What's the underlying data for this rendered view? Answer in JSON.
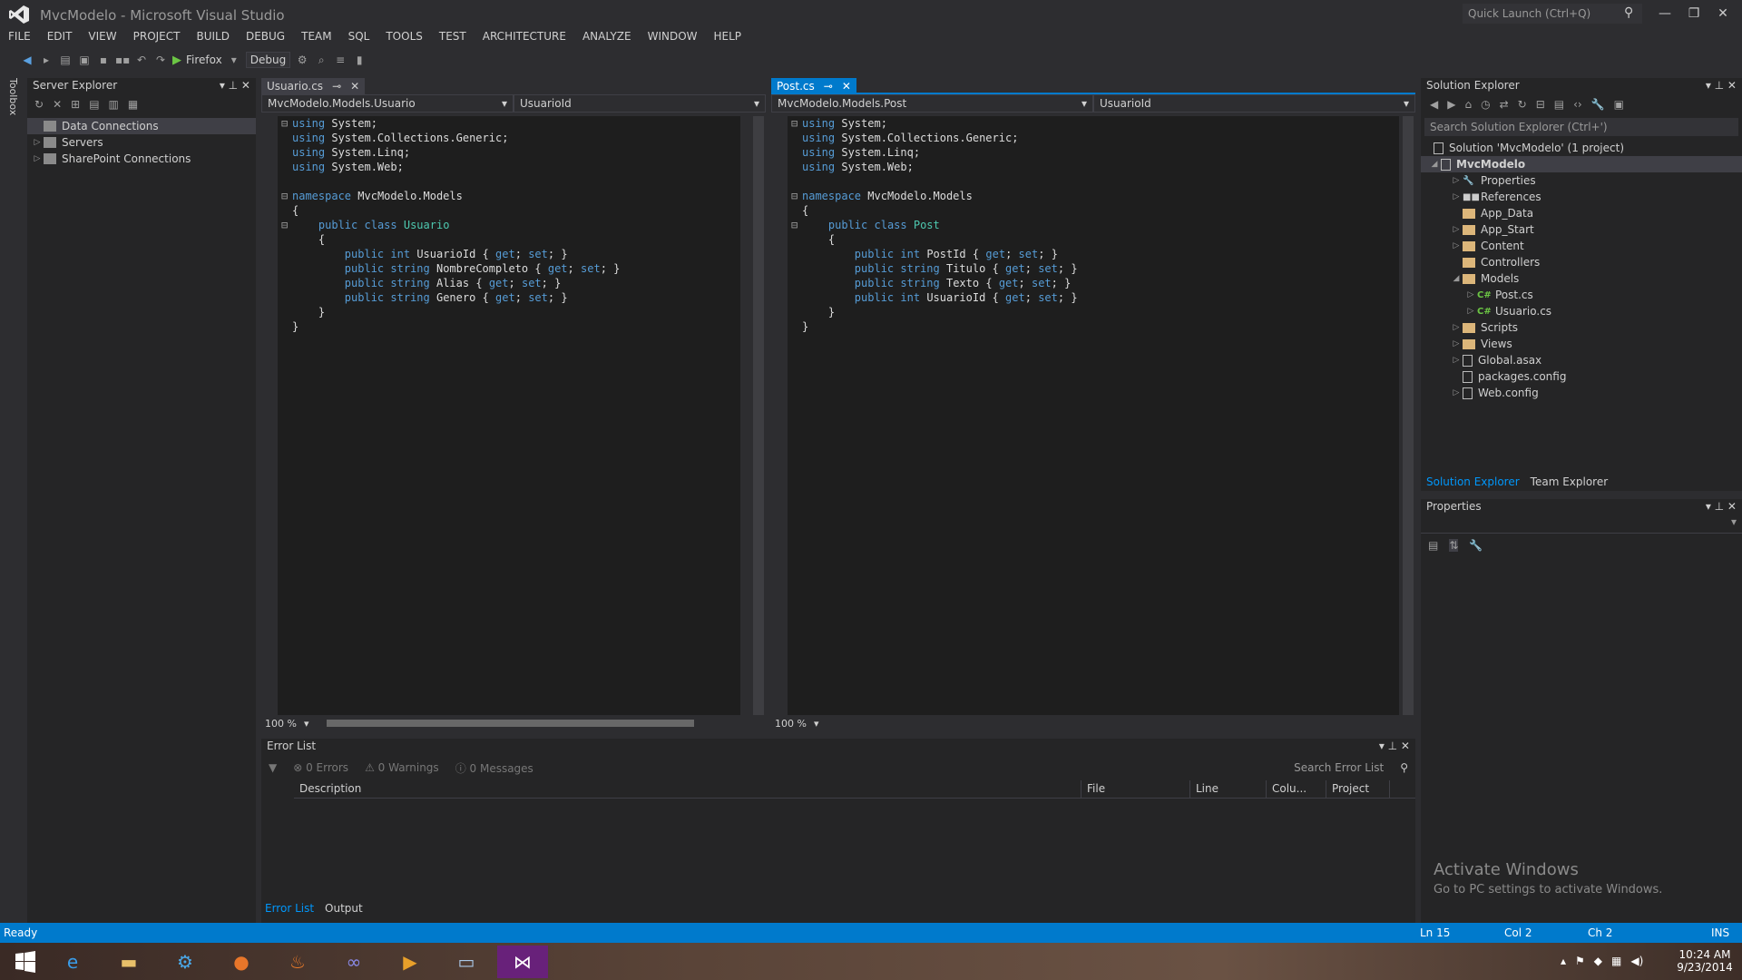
{
  "window": {
    "title": "MvcModelo - Microsoft Visual Studio",
    "quick_launch_placeholder": "Quick Launch (Ctrl+Q)"
  },
  "menu": [
    "FILE",
    "EDIT",
    "VIEW",
    "PROJECT",
    "BUILD",
    "DEBUG",
    "TEAM",
    "SQL",
    "TOOLS",
    "TEST",
    "ARCHITECTURE",
    "ANALYZE",
    "WINDOW",
    "HELP"
  ],
  "toolbar": {
    "run_target": "Firefox",
    "configuration": "Debug"
  },
  "toolbox_label": "Toolbox",
  "server_explorer": {
    "title": "Server Explorer",
    "items": [
      {
        "label": "Data Connections",
        "selected": true,
        "expandable": false
      },
      {
        "label": "Servers",
        "selected": false,
        "expandable": true
      },
      {
        "label": "SharePoint Connections",
        "selected": false,
        "expandable": true
      }
    ]
  },
  "editor_left": {
    "tab": "Usuario.cs",
    "nav_class": "MvcModelo.Models.Usuario",
    "nav_member": "UsuarioId",
    "zoom": "100 %",
    "lines": [
      "using System;",
      "using System.Collections.Generic;",
      "using System.Linq;",
      "using System.Web;",
      "",
      "namespace MvcModelo.Models",
      "{",
      "    public class Usuario",
      "    {",
      "        public int UsuarioId { get; set; }",
      "        public string NombreCompleto { get; set; }",
      "        public string Alias { get; set; }",
      "        public string Genero { get; set; }",
      "    }",
      "}"
    ]
  },
  "editor_right": {
    "tab": "Post.cs",
    "nav_class": "MvcModelo.Models.Post",
    "nav_member": "UsuarioId",
    "zoom": "100 %",
    "lines": [
      "using System;",
      "using System.Collections.Generic;",
      "using System.Linq;",
      "using System.Web;",
      "",
      "namespace MvcModelo.Models",
      "{",
      "    public class Post",
      "    {",
      "        public int PostId { get; set; }",
      "        public string Titulo { get; set; }",
      "        public string Texto { get; set; }",
      "        public int UsuarioId { get; set; }",
      "    }",
      "}"
    ]
  },
  "solution_explorer": {
    "title": "Solution Explorer",
    "search_placeholder": "Search Solution Explorer (Ctrl+')",
    "solution": "Solution 'MvcModelo' (1 project)",
    "project": "MvcModelo",
    "items": [
      {
        "label": "Properties",
        "icon": "wrench",
        "indent": 2,
        "expander": "collapsed"
      },
      {
        "label": "References",
        "icon": "references",
        "indent": 2,
        "expander": "collapsed"
      },
      {
        "label": "App_Data",
        "icon": "folder",
        "indent": 2,
        "expander": "none"
      },
      {
        "label": "App_Start",
        "icon": "folder",
        "indent": 2,
        "expander": "collapsed"
      },
      {
        "label": "Content",
        "icon": "folder",
        "indent": 2,
        "expander": "collapsed"
      },
      {
        "label": "Controllers",
        "icon": "folder",
        "indent": 2,
        "expander": "none"
      },
      {
        "label": "Models",
        "icon": "folder",
        "indent": 2,
        "expander": "expanded"
      },
      {
        "label": "Post.cs",
        "icon": "cs",
        "indent": 3,
        "expander": "collapsed"
      },
      {
        "label": "Usuario.cs",
        "icon": "cs",
        "indent": 3,
        "expander": "collapsed"
      },
      {
        "label": "Scripts",
        "icon": "folder",
        "indent": 2,
        "expander": "collapsed"
      },
      {
        "label": "Views",
        "icon": "folder",
        "indent": 2,
        "expander": "collapsed"
      },
      {
        "label": "Global.asax",
        "icon": "file",
        "indent": 2,
        "expander": "collapsed"
      },
      {
        "label": "packages.config",
        "icon": "file",
        "indent": 2,
        "expander": "none"
      },
      {
        "label": "Web.config",
        "icon": "file",
        "indent": 2,
        "expander": "collapsed"
      }
    ],
    "bottom_tabs": [
      "Solution Explorer",
      "Team Explorer"
    ]
  },
  "properties": {
    "title": "Properties"
  },
  "error_list": {
    "title": "Error List",
    "errors": "0 Errors",
    "warnings": "0 Warnings",
    "messages": "0 Messages",
    "search_placeholder": "Search Error List",
    "columns": [
      "Description",
      "File",
      "Line",
      "Colu...",
      "Project"
    ],
    "bottom_tabs": [
      "Error List",
      "Output"
    ]
  },
  "watermark": {
    "line1": "Activate Windows",
    "line2": "Go to PC settings to activate Windows."
  },
  "status": {
    "left": "Ready",
    "ln": "Ln 15",
    "col": "Col 2",
    "ch": "Ch 2",
    "mode": "INS"
  },
  "taskbar": {
    "time": "10:24 AM",
    "date": "9/23/2014"
  },
  "colors": {
    "accent": "#007acc",
    "keyword": "#569cd6",
    "type": "#4ec9b0",
    "background": "#1e1e1e"
  }
}
